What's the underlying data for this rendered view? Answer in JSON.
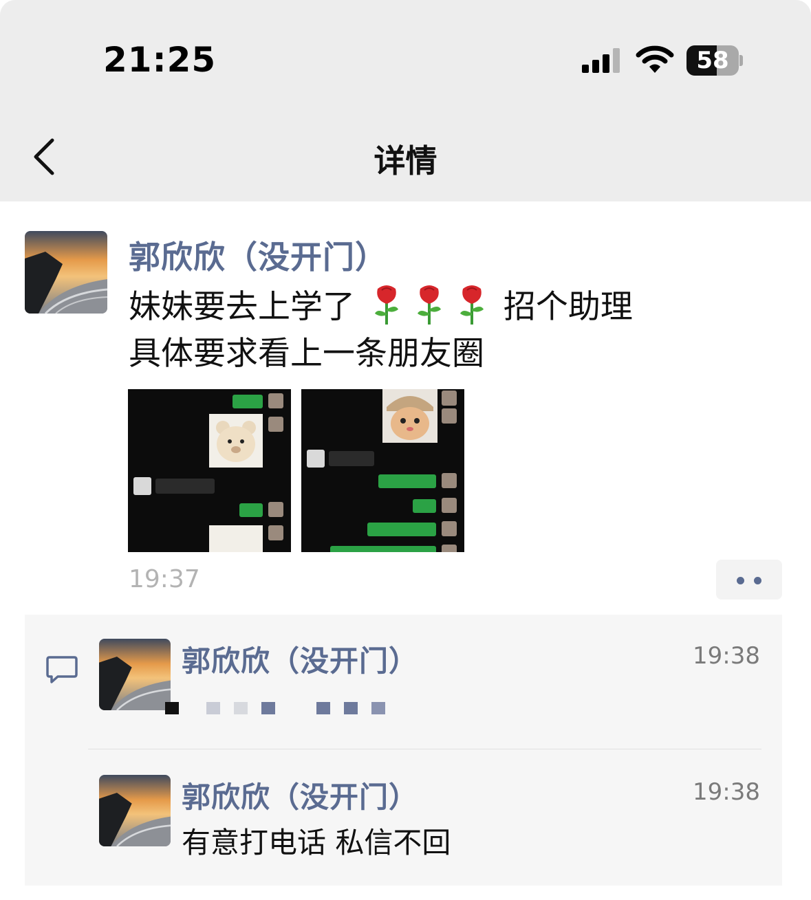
{
  "status_bar": {
    "time": "21:25",
    "battery": "58",
    "battery_level": 0.58
  },
  "nav": {
    "title": "详情"
  },
  "post": {
    "author": "郭欣欣（没开门）",
    "text_line1_before": "妹妹要去上学了",
    "text_line1_after": "招个助理",
    "text_line2": "具体要求看上一条朋友圈",
    "emoji": "🌹",
    "time": "19:37"
  },
  "comments": [
    {
      "author": "郭欣欣（没开门）",
      "time": "19:38",
      "text": ""
    },
    {
      "author": "郭欣欣（没开门）",
      "time": "19:38",
      "text": "有意打电话 私信不回"
    }
  ],
  "colors": {
    "name_link": "#5a6b91",
    "header_bg": "#ededed",
    "comments_bg": "#f6f6f6"
  }
}
